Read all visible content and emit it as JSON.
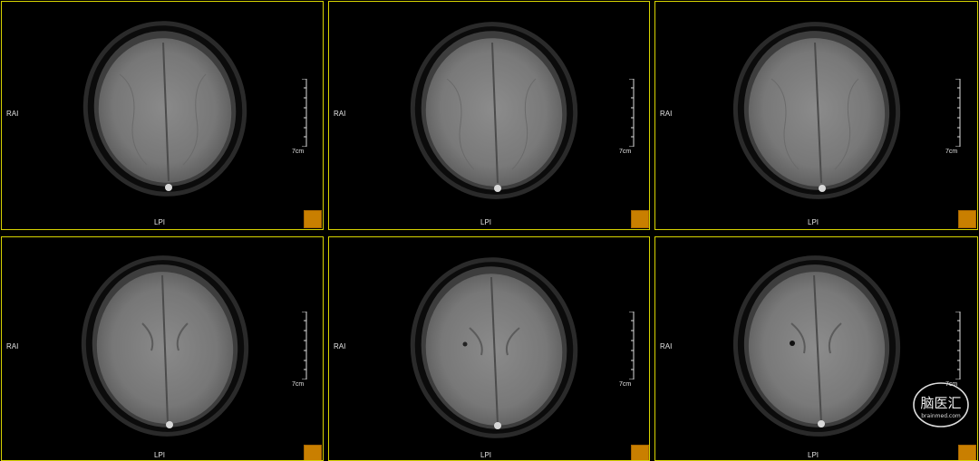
{
  "viewer": {
    "frame_color": "#d8d400",
    "corner_box_color": "#c97f00",
    "panels": [
      {
        "id": "p1",
        "left_label": "RAI",
        "bottom_label": "LPI",
        "scale_label": "7cm"
      },
      {
        "id": "p2",
        "left_label": "RAI",
        "bottom_label": "LPI",
        "scale_label": "7cm"
      },
      {
        "id": "p3",
        "left_label": "RAI",
        "bottom_label": "LPI",
        "scale_label": "7cm"
      },
      {
        "id": "p4",
        "left_label": "RAI",
        "bottom_label": "LPI",
        "scale_label": "7cm"
      },
      {
        "id": "p5",
        "left_label": "RAI",
        "bottom_label": "LPI",
        "scale_label": "7cm"
      },
      {
        "id": "p6",
        "left_label": "RAI",
        "bottom_label": "LPI",
        "scale_label": "7cm"
      }
    ]
  },
  "watermark": {
    "title": "脑医汇",
    "subtitle": "brainmed.com"
  }
}
